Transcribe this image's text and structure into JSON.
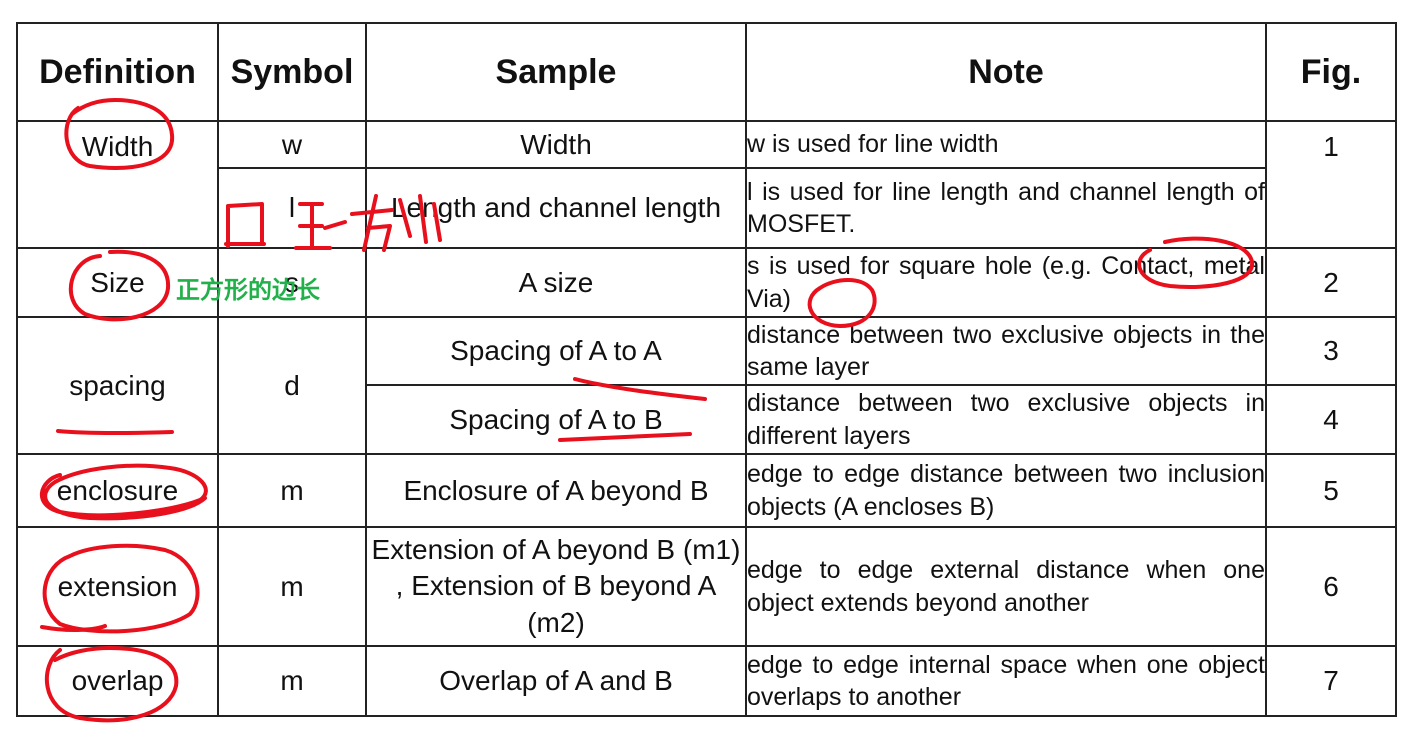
{
  "headers": {
    "definition": "Definition",
    "symbol": "Symbol",
    "sample": "Sample",
    "note": "Note",
    "fig": "Fig."
  },
  "rows": {
    "width": {
      "definition": "Width",
      "symbol": "w",
      "sample": "Width",
      "note": "w is used for line width",
      "fig": "1"
    },
    "length": {
      "symbol": "l",
      "sample": "Length and channel length",
      "note": "l is used for line length and channel length of MOSFET."
    },
    "size": {
      "definition": "Size",
      "symbol": "s",
      "sample": "A size",
      "note": "s is used for square hole (e.g. Contact, metal Via)",
      "fig": "2"
    },
    "spacing_aa": {
      "definition": "spacing",
      "symbol": "d",
      "sample": "Spacing of A to A",
      "note": "distance between two exclusive objects in the same layer",
      "fig": "3"
    },
    "spacing_ab": {
      "sample": "Spacing of A to B",
      "note": "distance between two exclusive objects in different layers",
      "fig": "4"
    },
    "enclosure": {
      "definition": "enclosure",
      "symbol": "m",
      "sample": "Enclosure of A beyond B",
      "note": "edge to edge distance between two inclusion objects (A encloses B)",
      "fig": "5"
    },
    "extension": {
      "definition": "extension",
      "symbol": "m",
      "sample": "Extension of A beyond B (m1) , Extension of B beyond A (m2)",
      "note": "edge to edge external distance when one object extends beyond another",
      "fig": "6"
    },
    "overlap": {
      "definition": "overlap",
      "symbol": "m",
      "sample": "Overlap of A and B",
      "note": "edge to edge internal space when one object overlaps to another",
      "fig": "7"
    }
  },
  "annotations": {
    "size_note_cn": "正方形的边长",
    "handwritten_cn": "正方形",
    "ink_color": "#e8101c",
    "cn_note_color": "#22b04a"
  }
}
